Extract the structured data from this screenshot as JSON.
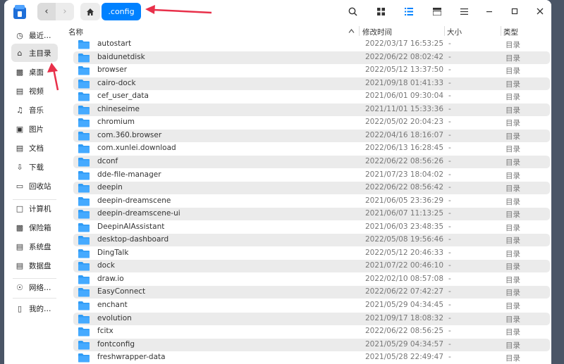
{
  "titlebar": {
    "back_icon": "chevron-left-icon",
    "forward_icon": "chevron-right-icon",
    "home_icon": "home-icon",
    "current_crumb": ".config",
    "search_icon": "search-icon",
    "icon_view_icon": "grid-icon",
    "list_view_icon": "list-icon",
    "detail_view_icon": "detail-icon",
    "menu_icon": "menu-icon",
    "minimize_icon": "minimize-icon",
    "maximize_icon": "maximize-icon",
    "close_icon": "close-icon"
  },
  "sidebar": {
    "items": [
      {
        "label": "最近…",
        "icon": "clock-icon"
      },
      {
        "label": "主目录",
        "icon": "home-icon"
      },
      {
        "label": "桌面",
        "icon": "desktop-icon"
      },
      {
        "label": "视频",
        "icon": "video-icon"
      },
      {
        "label": "音乐",
        "icon": "music-icon"
      },
      {
        "label": "图片",
        "icon": "image-icon"
      },
      {
        "label": "文档",
        "icon": "document-icon"
      },
      {
        "label": "下载",
        "icon": "download-icon"
      },
      {
        "label": "回收站",
        "icon": "trash-icon"
      },
      {
        "label": "计算机",
        "icon": "computer-icon"
      },
      {
        "label": "保险箱",
        "icon": "vault-icon"
      },
      {
        "label": "系统盘",
        "icon": "disk-icon"
      },
      {
        "label": "数据盘",
        "icon": "disk-icon"
      },
      {
        "label": "网络…",
        "icon": "network-icon"
      },
      {
        "label": "我的…",
        "icon": "phone-icon"
      }
    ]
  },
  "columns": {
    "name": "名称",
    "modified": "修改时间",
    "size": "大小",
    "type": "类型"
  },
  "files": [
    {
      "name": "autostart",
      "modified": "2022/03/17 16:53:25",
      "size": "-",
      "type": "目录"
    },
    {
      "name": "baidunetdisk",
      "modified": "2022/06/22 08:02:42",
      "size": "-",
      "type": "目录"
    },
    {
      "name": "browser",
      "modified": "2022/05/12 13:37:50",
      "size": "-",
      "type": "目录"
    },
    {
      "name": "cairo-dock",
      "modified": "2021/09/18 01:41:33",
      "size": "-",
      "type": "目录"
    },
    {
      "name": "cef_user_data",
      "modified": "2021/06/01 09:30:04",
      "size": "-",
      "type": "目录"
    },
    {
      "name": "chineseime",
      "modified": "2021/11/01 15:33:36",
      "size": "-",
      "type": "目录"
    },
    {
      "name": "chromium",
      "modified": "2022/05/02 20:04:23",
      "size": "-",
      "type": "目录"
    },
    {
      "name": "com.360.browser",
      "modified": "2022/04/16 18:16:07",
      "size": "-",
      "type": "目录"
    },
    {
      "name": "com.xunlei.download",
      "modified": "2022/06/13 16:28:45",
      "size": "-",
      "type": "目录"
    },
    {
      "name": "dconf",
      "modified": "2022/06/22 08:56:26",
      "size": "-",
      "type": "目录"
    },
    {
      "name": "dde-file-manager",
      "modified": "2021/07/23 18:04:02",
      "size": "-",
      "type": "目录"
    },
    {
      "name": "deepin",
      "modified": "2022/06/22 08:56:42",
      "size": "-",
      "type": "目录"
    },
    {
      "name": "deepin-dreamscene",
      "modified": "2021/06/05 23:36:29",
      "size": "-",
      "type": "目录"
    },
    {
      "name": "deepin-dreamscene-ui",
      "modified": "2021/06/07 11:13:25",
      "size": "-",
      "type": "目录"
    },
    {
      "name": "DeepinAIAssistant",
      "modified": "2021/06/03 23:48:35",
      "size": "-",
      "type": "目录"
    },
    {
      "name": "desktop-dashboard",
      "modified": "2022/05/08 19:56:46",
      "size": "-",
      "type": "目录"
    },
    {
      "name": "DingTalk",
      "modified": "2022/05/12 20:46:33",
      "size": "-",
      "type": "目录"
    },
    {
      "name": "dock",
      "modified": "2021/07/22 00:46:10",
      "size": "-",
      "type": "目录"
    },
    {
      "name": "draw.io",
      "modified": "2022/02/10 08:57:08",
      "size": "-",
      "type": "目录"
    },
    {
      "name": "EasyConnect",
      "modified": "2022/06/22 07:42:27",
      "size": "-",
      "type": "目录"
    },
    {
      "name": "enchant",
      "modified": "2021/05/29 04:34:45",
      "size": "-",
      "type": "目录"
    },
    {
      "name": "evolution",
      "modified": "2021/09/17 18:08:32",
      "size": "-",
      "type": "目录"
    },
    {
      "name": "fcitx",
      "modified": "2022/06/22 08:56:25",
      "size": "-",
      "type": "目录"
    },
    {
      "name": "fontconfig",
      "modified": "2021/05/29 04:34:57",
      "size": "-",
      "type": "目录"
    },
    {
      "name": "freshwrapper-data",
      "modified": "2021/05/28 22:49:47",
      "size": "-",
      "type": "目录"
    }
  ],
  "colors": {
    "accent": "#0081ff",
    "folder": "#2f9bf5",
    "annotation_arrow": "#e8304a"
  }
}
